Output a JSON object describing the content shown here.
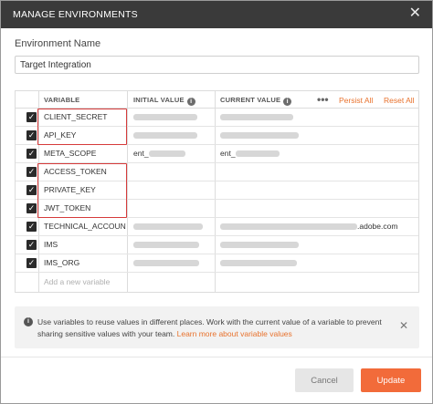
{
  "window": {
    "title": "MANAGE ENVIRONMENTS",
    "close_glyph": "✕"
  },
  "environment": {
    "label": "Environment Name",
    "value": "Target Integration"
  },
  "table": {
    "headers": {
      "variable": "VARIABLE",
      "initial_value": "INITIAL VALUE",
      "current_value": "CURRENT VALUE"
    },
    "info_icon": "info-icon",
    "menu_glyph": "•••",
    "persist_all": "Persist All",
    "reset_all": "Reset All",
    "rows": [
      {
        "checked": true,
        "variable": "CLIENT_SECRET",
        "initial": "",
        "current": "",
        "initial_hidden": true,
        "current_hidden": true
      },
      {
        "checked": true,
        "variable": "API_KEY",
        "initial": "",
        "current": "",
        "initial_hidden": true,
        "current_hidden": true
      },
      {
        "checked": true,
        "variable": "META_SCOPE",
        "initial": "ent_",
        "current": "ent_",
        "initial_hidden": true,
        "current_hidden": true
      },
      {
        "checked": true,
        "variable": "ACCESS_TOKEN",
        "initial": "",
        "current": "",
        "initial_hidden": false,
        "current_hidden": false
      },
      {
        "checked": true,
        "variable": "PRIVATE_KEY",
        "initial": "",
        "current": "",
        "initial_hidden": false,
        "current_hidden": false
      },
      {
        "checked": true,
        "variable": "JWT_TOKEN",
        "initial": "",
        "current": "",
        "initial_hidden": false,
        "current_hidden": false
      },
      {
        "checked": true,
        "variable": "TECHNICAL_ACCOUNT_I",
        "initial": "",
        "current": ".adobe.com",
        "initial_hidden": true,
        "current_hidden": true
      },
      {
        "checked": true,
        "variable": "IMS",
        "initial": "",
        "current": "",
        "initial_hidden": true,
        "current_hidden": true
      },
      {
        "checked": true,
        "variable": "IMS_ORG",
        "initial": "",
        "current": "",
        "initial_hidden": true,
        "current_hidden": true
      }
    ],
    "add_placeholder": "Add a new variable"
  },
  "info": {
    "text": "Use variables to reuse values in different places. Work with the current value of a variable to prevent sharing sensitive values with your team.",
    "link": "Learn more about variable values",
    "close_glyph": "✕"
  },
  "buttons": {
    "cancel": "Cancel",
    "update": "Update"
  },
  "colors": {
    "accent": "#e8722d",
    "update_button": "#f26b3a",
    "highlight_box": "#d63b3b",
    "titlebar": "#3a3a3a"
  }
}
